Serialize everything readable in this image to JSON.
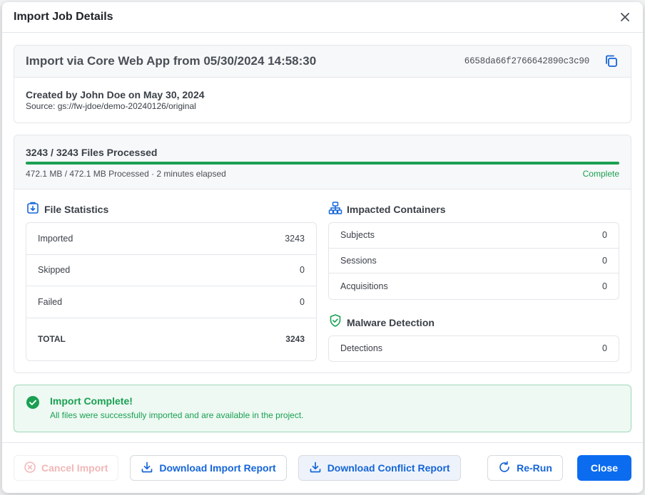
{
  "modal": {
    "title": "Import Job Details"
  },
  "summary": {
    "import_title": "Import via Core Web App from 05/30/2024 14:58:30",
    "job_id": "6658da66f2766642890c3c90",
    "created_by": "Created by John Doe on May 30, 2024",
    "source": "Source: gs://fw-jdoe/demo-20240126/original"
  },
  "progress": {
    "files_processed": "3243 / 3243 Files Processed",
    "meta": "472.1 MB / 472.1 MB Processed · 2 minutes elapsed",
    "status": "Complete",
    "percent": 100
  },
  "file_statistics": {
    "title": "File Statistics",
    "rows": [
      {
        "label": "Imported",
        "value": "3243"
      },
      {
        "label": "Skipped",
        "value": "0"
      },
      {
        "label": "Failed",
        "value": "0"
      }
    ],
    "total": {
      "label": "TOTAL",
      "value": "3243"
    }
  },
  "impacted_containers": {
    "title": "Impacted Containers",
    "rows": [
      {
        "label": "Subjects",
        "value": "0"
      },
      {
        "label": "Sessions",
        "value": "0"
      },
      {
        "label": "Acquisitions",
        "value": "0"
      }
    ]
  },
  "malware": {
    "title": "Malware Detection",
    "rows": [
      {
        "label": "Detections",
        "value": "0"
      }
    ]
  },
  "alert": {
    "title": "Import Complete!",
    "text": "All files were successfully imported and are available in the project."
  },
  "footer": {
    "cancel_label": "Cancel Import",
    "download_import_label": "Download Import Report",
    "download_conflict_label": "Download Conflict Report",
    "rerun_label": "Re-Run",
    "close_label": "Close"
  },
  "colors": {
    "primary": "#0b6cf0",
    "success": "#1aa052",
    "disabled_red": "#f2b7b7"
  },
  "icons": {
    "close": "close-icon",
    "copy": "copy-icon",
    "file_stats": "file-import-icon",
    "containers": "hierarchy-icon",
    "malware": "shield-check-icon",
    "success": "check-circle-icon",
    "cancel": "x-circle-icon",
    "download": "download-icon",
    "rerun": "refresh-icon"
  }
}
